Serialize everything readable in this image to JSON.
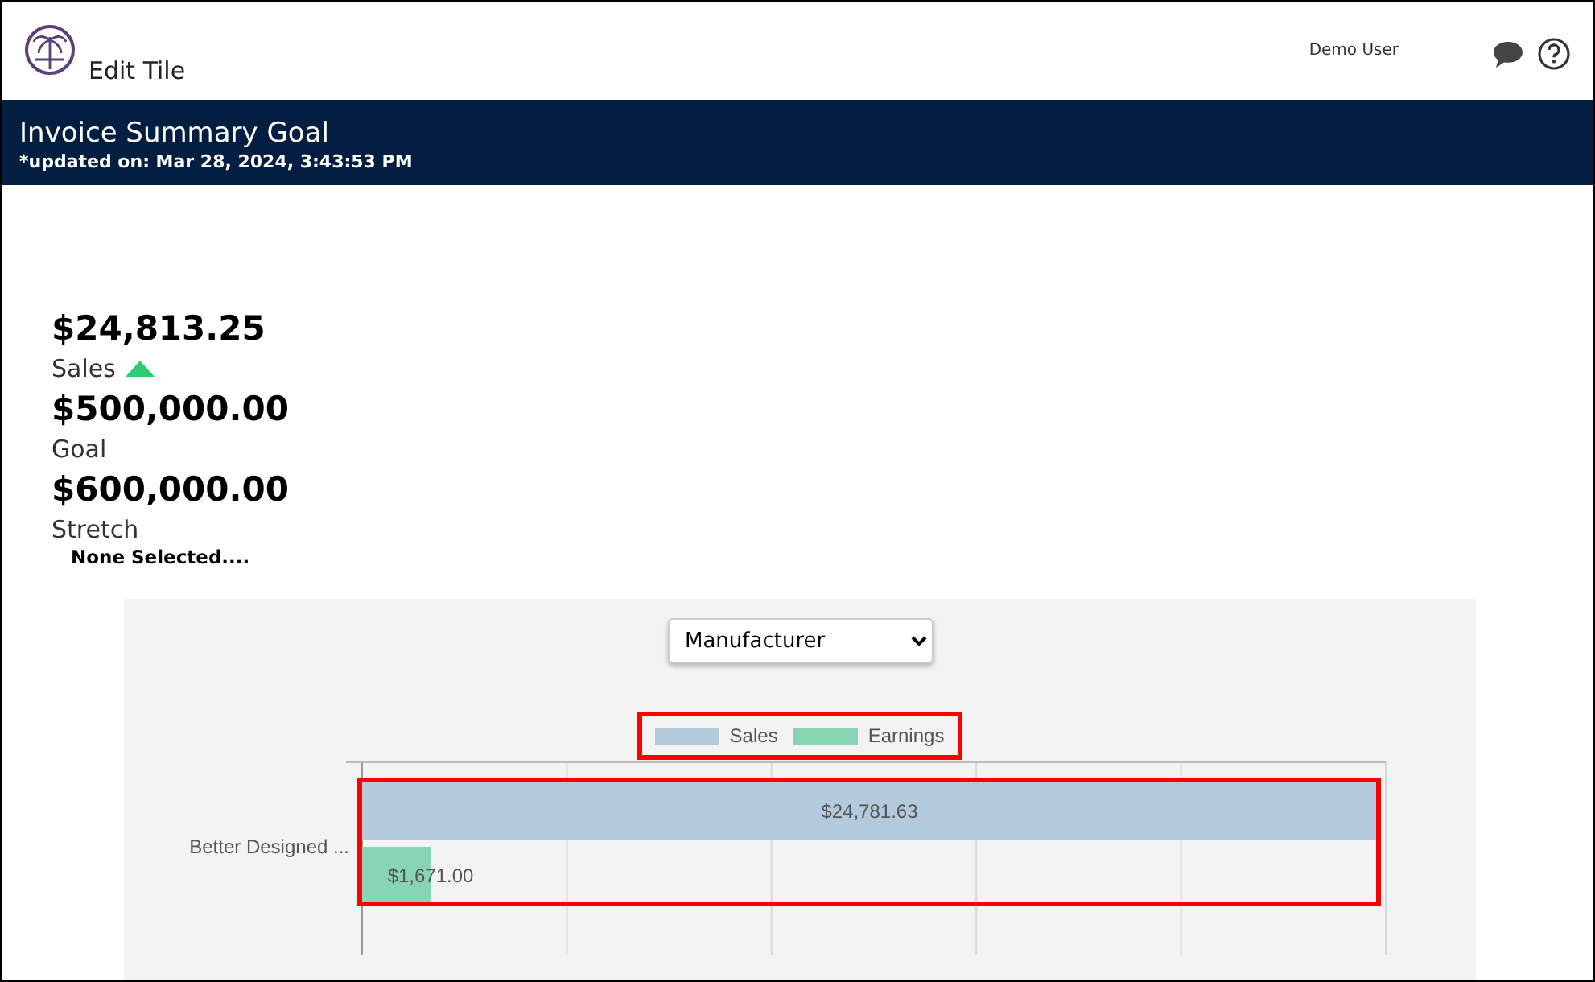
{
  "header": {
    "title": "Edit Tile",
    "user": "Demo User"
  },
  "banner": {
    "title": "Invoice Summary Goal",
    "updated": "*updated on: Mar 28, 2024, 3:43:53 PM"
  },
  "metrics": [
    {
      "value": "$24,813.25",
      "label": "Sales",
      "rising": true
    },
    {
      "value": "$500,000.00",
      "label": "Goal",
      "rising": false
    },
    {
      "value": "$600,000.00",
      "label": "Stretch",
      "rising": false
    }
  ],
  "selection_note": "None Selected....",
  "group_select": {
    "value": "Manufacturer"
  },
  "chart_data": {
    "type": "bar",
    "orientation": "horizontal",
    "categories": [
      "Better Designed ..."
    ],
    "series": [
      {
        "name": "Sales",
        "color": "#b3cadc",
        "values": [
          24781.63
        ],
        "value_labels": [
          "$24,781.63"
        ]
      },
      {
        "name": "Earnings",
        "color": "#88d4b4",
        "values": [
          1671.0
        ],
        "value_labels": [
          "$1,671.00"
        ]
      }
    ]
  }
}
